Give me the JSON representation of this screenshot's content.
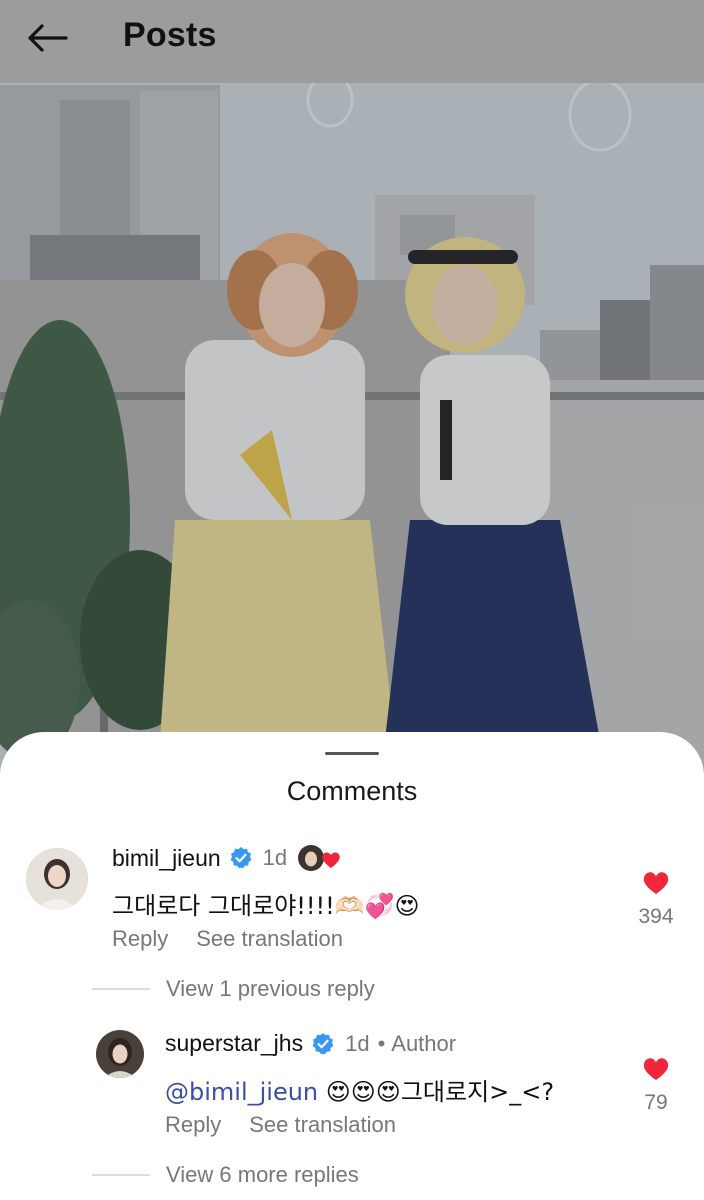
{
  "header": {
    "title": "Posts",
    "back_icon": "arrow-left-icon"
  },
  "sheet": {
    "title": "Comments"
  },
  "comments": [
    {
      "username": "bimil_jieun",
      "verified": true,
      "time": "1d",
      "liked_by_author": true,
      "text": "그대로다 그대로야!!!!🫶🏻💞😍",
      "actions": {
        "reply": "Reply",
        "translate": "See translation"
      },
      "likes": "394"
    }
  ],
  "replies_previous": "View 1 previous reply",
  "reply": {
    "username": "superstar_jhs",
    "verified": true,
    "time": "1d",
    "separator": "•",
    "badge": "Author",
    "mention": "@bimil_jieun",
    "text": " 😍😍😍그대로지>_<?",
    "actions": {
      "reply": "Reply",
      "translate": "See translation"
    },
    "likes": "79"
  },
  "replies_more": "View 6 more replies",
  "colors": {
    "like_red": "#f0263b",
    "verified_blue": "#3897f0",
    "mention_blue": "#3a4fa8",
    "topbar_gray": "#9c9c9c"
  }
}
